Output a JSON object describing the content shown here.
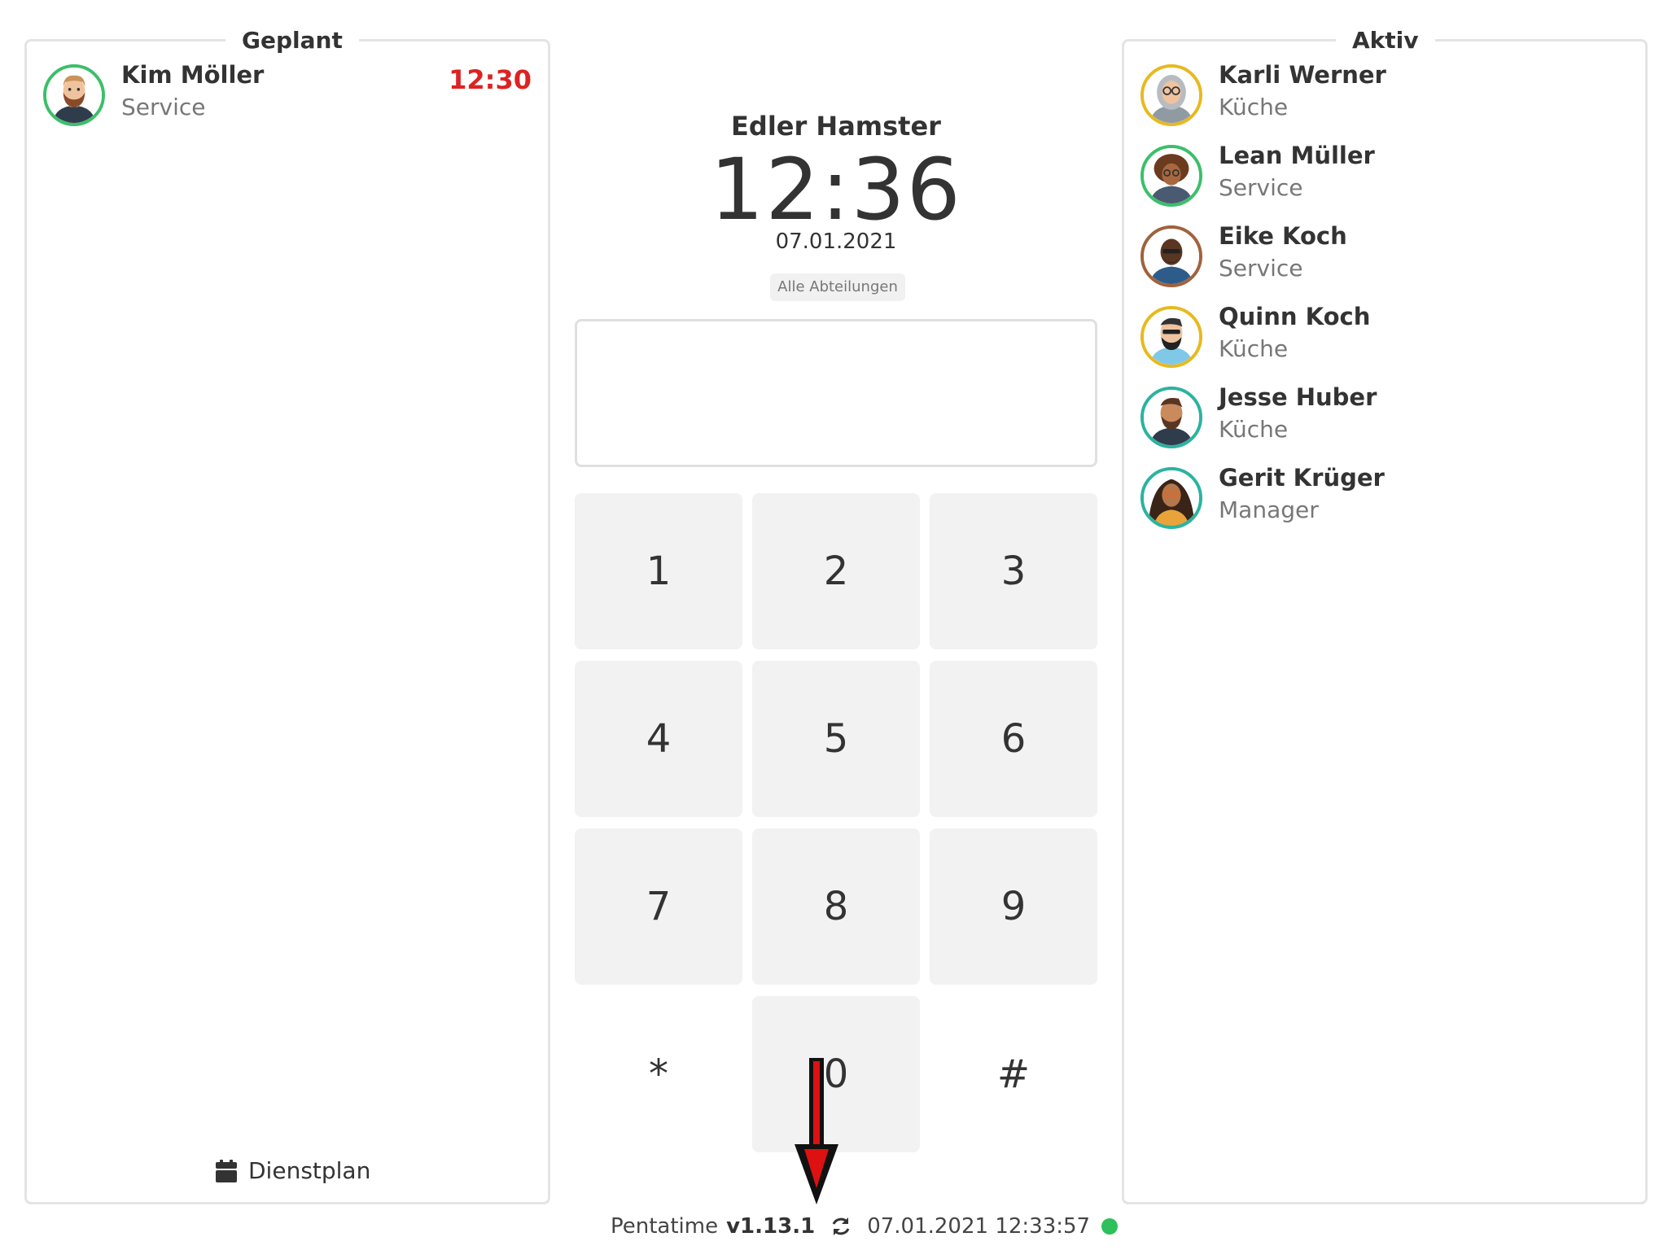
{
  "planned": {
    "title": "Geplant",
    "employees": [
      {
        "name": "Kim Möller",
        "department": "Service",
        "time": "12:30"
      }
    ],
    "schedule_label": "Dienstplan"
  },
  "active": {
    "title": "Aktiv",
    "employees": [
      {
        "name": "Karli Werner",
        "department": "Küche"
      },
      {
        "name": "Lean Müller",
        "department": "Service"
      },
      {
        "name": "Eike Koch",
        "department": "Service"
      },
      {
        "name": "Quinn Koch",
        "department": "Küche"
      },
      {
        "name": "Jesse Huber",
        "department": "Küche"
      },
      {
        "name": "Gerit Krüger",
        "department": "Manager"
      }
    ]
  },
  "terminal": {
    "company": "Edler Hamster",
    "time": "12:36",
    "date": "07.01.2021",
    "department_filter": "Alle Abteilungen",
    "pin_value": ""
  },
  "keypad": {
    "keys": [
      "1",
      "2",
      "3",
      "4",
      "5",
      "6",
      "7",
      "8",
      "9",
      "*",
      "0",
      "#"
    ]
  },
  "footer": {
    "app_name": "Pentatime",
    "version": "v1.13.1",
    "last_sync": "07.01.2021 12:33:57",
    "status_color": "#2ec05a"
  },
  "colors": {
    "late_time": "#dd2222",
    "avatar_ring_green": "#3cbf6a",
    "avatar_ring_brown": "#a0623d",
    "avatar_ring_yellow": "#e8b91f",
    "avatar_ring_teal": "#2bb3a0",
    "annotation_arrow": "#dd1111"
  },
  "annotation": {
    "type": "arrow-down",
    "icon": "arrow-icon"
  }
}
